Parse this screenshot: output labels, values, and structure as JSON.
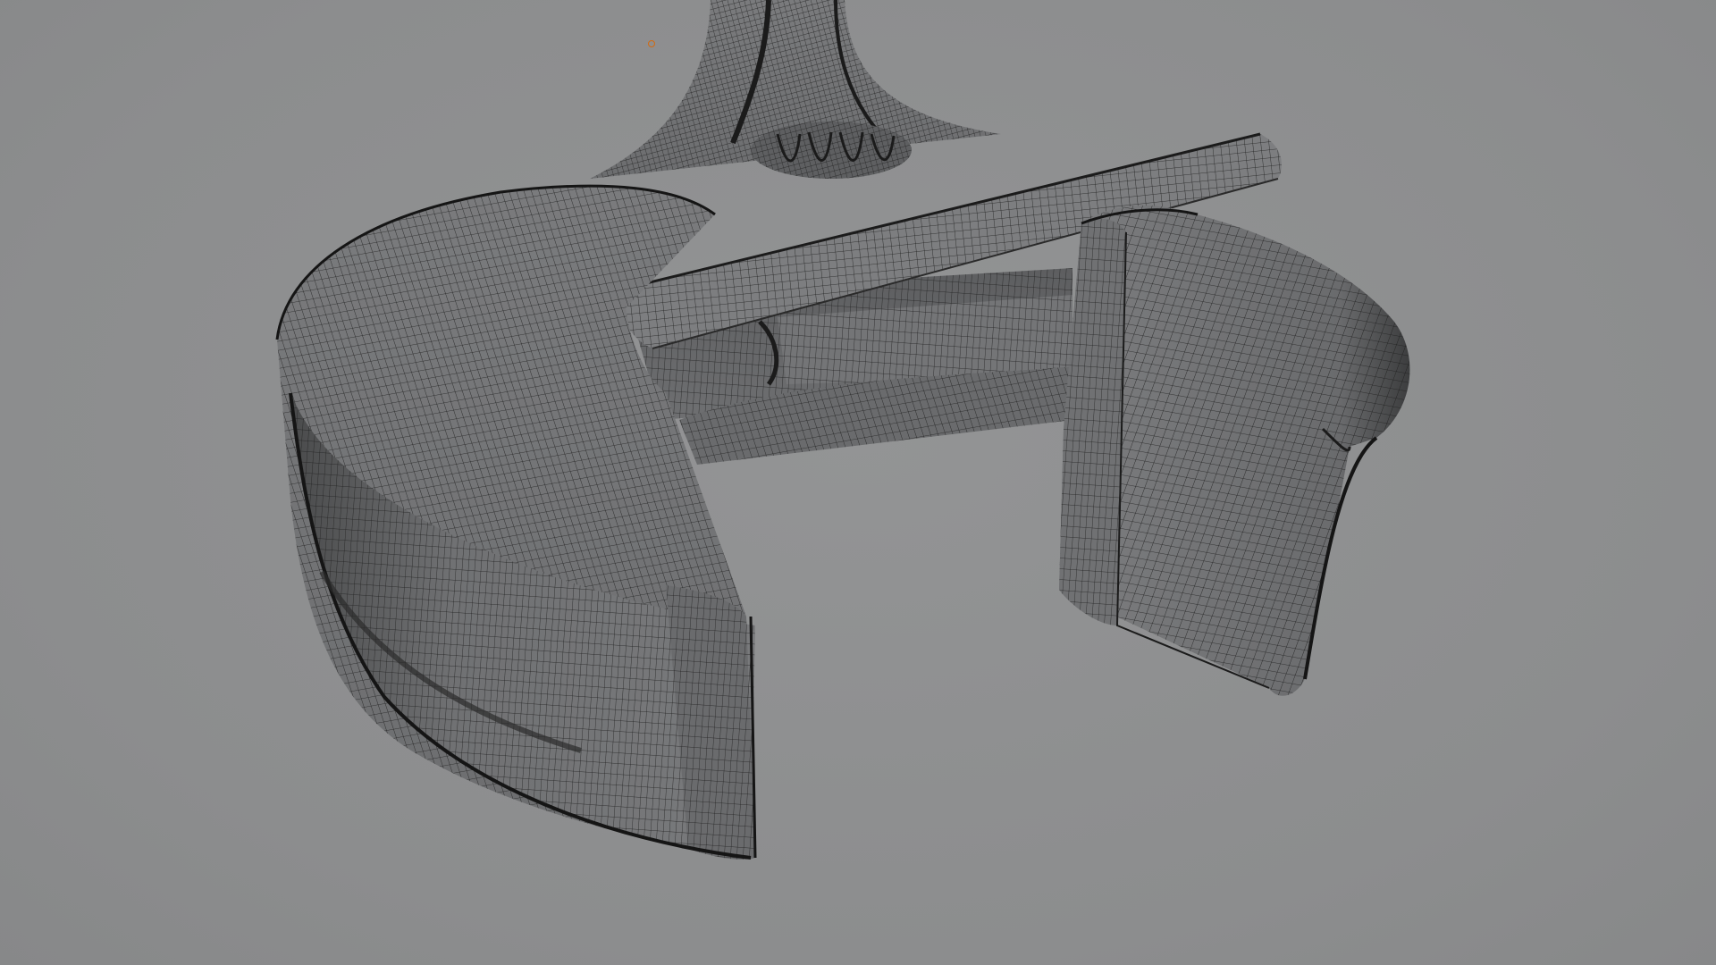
{
  "viewport": {
    "mode": "wireframe-on-shaded",
    "background_color": "#8e8f90",
    "mesh_color": "#6f7072",
    "wire_color": "#1f1f1f",
    "origin_color": "#d46a10"
  },
  "object": {
    "icon": "adjustable-wrench-jaw-mesh"
  },
  "overlay_icons": [
    "origin-point-icon"
  ]
}
